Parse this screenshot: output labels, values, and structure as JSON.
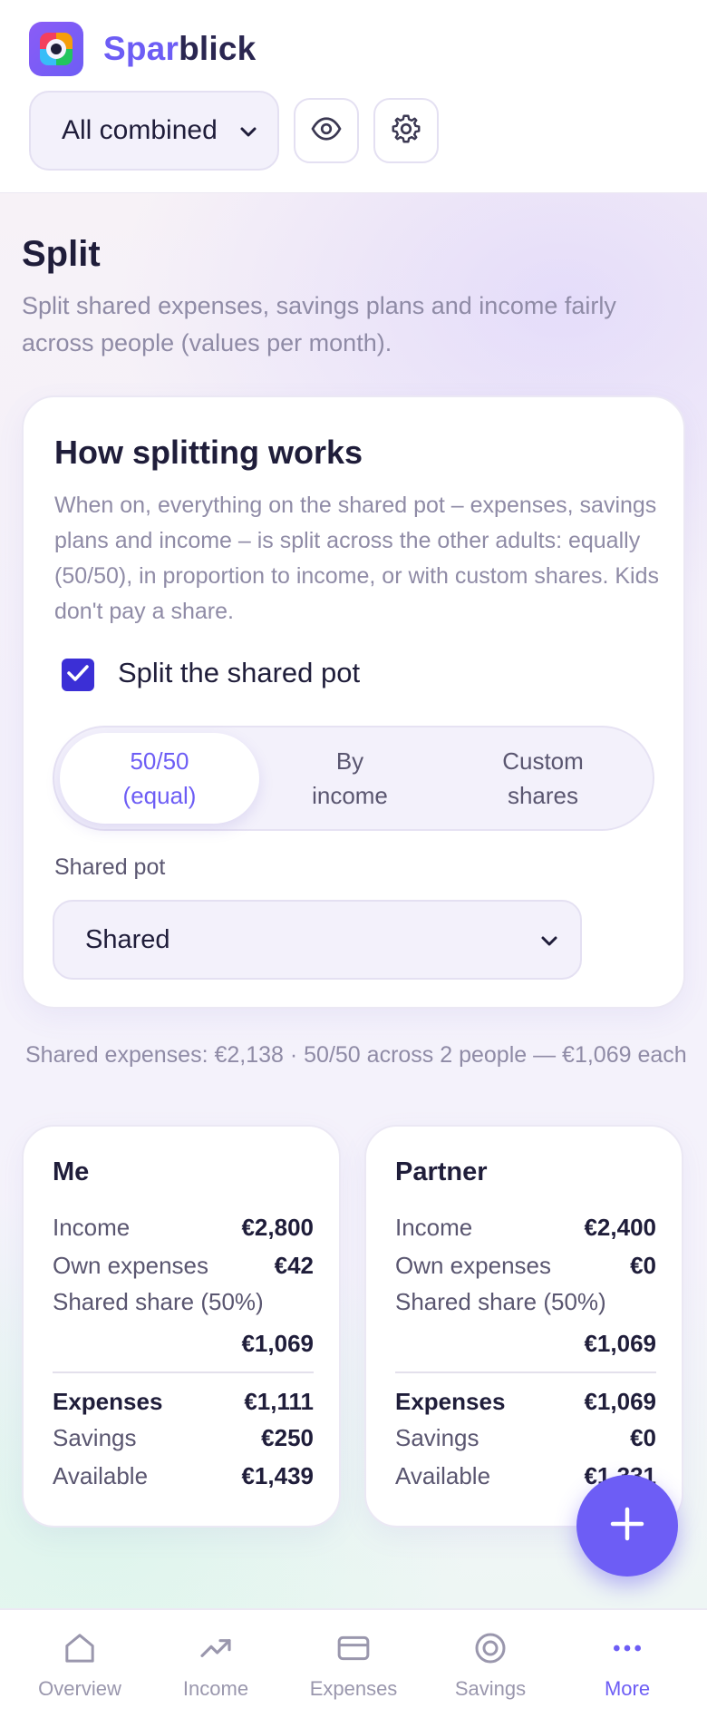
{
  "app": {
    "brand_part1": "Spar",
    "brand_part2": "blick",
    "scope_select": {
      "value": "All combined",
      "options": [
        "All combined"
      ]
    }
  },
  "page": {
    "title": "Split",
    "subtitle": "Split shared expenses, savings plans and income fairly across people (values per month)."
  },
  "how_card": {
    "title": "How splitting works",
    "description": "When on, everything on the shared pot – expenses, savings plans and income – is split across the other adults: equally (50/50), in proportion to income, or with custom shares. Kids don't pay a share.",
    "checkbox_label": "Split the shared pot",
    "checkbox_checked": true,
    "modes": [
      {
        "line1": "50/50",
        "line2": "(equal)",
        "active": true
      },
      {
        "line1": "By",
        "line2": "income",
        "active": false
      },
      {
        "line1": "Custom",
        "line2": "shares",
        "active": false
      }
    ],
    "pot_label": "Shared pot",
    "pot_value": "Shared"
  },
  "summary": "Shared expenses: €2,138 · 50/50 across 2 people — €1,069 each",
  "people": [
    {
      "name": "Me",
      "income_label": "Income",
      "income": "€2,800",
      "own_label": "Own expenses",
      "own": "€42",
      "share_label": "Shared share (50%)",
      "share": "€1,069",
      "expenses_label": "Expenses",
      "expenses": "€1,111",
      "savings_label": "Savings",
      "savings": "€250",
      "available_label": "Available",
      "available": "€1,439"
    },
    {
      "name": "Partner",
      "income_label": "Income",
      "income": "€2,400",
      "own_label": "Own expenses",
      "own": "€0",
      "share_label": "Shared share (50%)",
      "share": "€1,069",
      "expenses_label": "Expenses",
      "expenses": "€1,069",
      "savings_label": "Savings",
      "savings": "€0",
      "available_label": "Available",
      "available": "€1,331"
    }
  ],
  "nav": [
    {
      "label": "Overview",
      "icon": "home-icon",
      "active": false
    },
    {
      "label": "Income",
      "icon": "trending-up-icon",
      "active": false
    },
    {
      "label": "Expenses",
      "icon": "card-icon",
      "active": false
    },
    {
      "label": "Savings",
      "icon": "target-icon",
      "active": false
    },
    {
      "label": "More",
      "icon": "more-icon",
      "active": true
    }
  ],
  "colors": {
    "accent": "#6d5df5",
    "checkbox": "#3b2fd6",
    "text": "#1f1d3a",
    "muted": "#8f8ba6"
  }
}
